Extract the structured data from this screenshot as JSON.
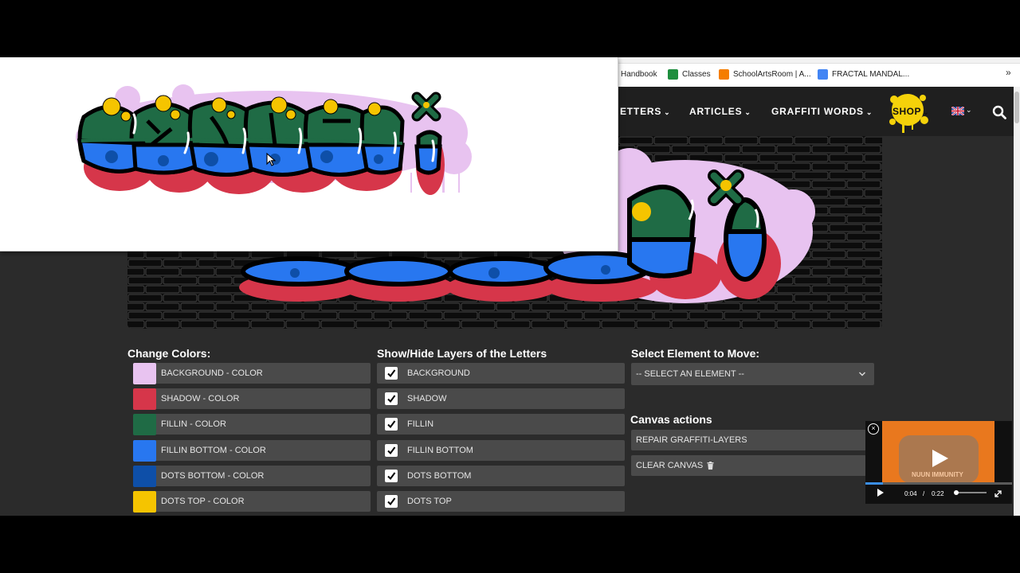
{
  "bookmarks": [
    {
      "label": "Handbook",
      "icon": "none"
    },
    {
      "label": "Classes",
      "icon": "classroom-icon",
      "color": "#1e8e3e"
    },
    {
      "label": "SchoolArtsRoom | A...",
      "icon": "blogger-icon",
      "color": "#f57d00"
    },
    {
      "label": "FRACTAL MANDAL...",
      "icon": "docs-icon",
      "color": "#4285f4"
    }
  ],
  "bookmarks_more": "»",
  "nav": {
    "items": [
      {
        "label": "ETTERS"
      },
      {
        "label": "ARTICLES"
      },
      {
        "label": "GRAFFITI WORDS"
      }
    ],
    "shop": "SHOP",
    "chevron": "⌄",
    "shop_color": "#f5d20a"
  },
  "graffiti": {
    "word": "SaGVZZi",
    "colors": {
      "background": "#e8c3f0",
      "shadow": "#d6364a",
      "fillin": "#1f6b45",
      "fillin_bottom": "#2877f0",
      "dots_bottom": "#0e4fa8",
      "dots_top": "#f5c400"
    }
  },
  "change_colors": {
    "title": "Change Colors:",
    "items": [
      {
        "label": "BACKGROUND - COLOR",
        "color": "#e8c3f0"
      },
      {
        "label": "SHADOW - COLOR",
        "color": "#d6364a"
      },
      {
        "label": "FILLIN - COLOR",
        "color": "#1f6b45"
      },
      {
        "label": "FILLIN BOTTOM - COLOR",
        "color": "#2877f0"
      },
      {
        "label": "DOTS BOTTOM - COLOR",
        "color": "#0e4fa8"
      },
      {
        "label": "DOTS TOP - COLOR",
        "color": "#f5c400"
      }
    ]
  },
  "layers": {
    "title": "Show/Hide Layers of the Letters",
    "items": [
      {
        "label": "BACKGROUND",
        "checked": true
      },
      {
        "label": "SHADOW",
        "checked": true
      },
      {
        "label": "FILLIN",
        "checked": true
      },
      {
        "label": "FILLIN BOTTOM",
        "checked": true
      },
      {
        "label": "DOTS BOTTOM",
        "checked": true
      },
      {
        "label": "DOTS TOP",
        "checked": true
      }
    ]
  },
  "move": {
    "title": "Select Element to Move:",
    "selected": "-- SELECT AN ELEMENT --"
  },
  "canvas_actions": {
    "title": "Canvas actions",
    "repair": "REPAIR GRAFFITI-LAYERS",
    "clear": "CLEAR CANVAS",
    "clear_icon": "trash-icon"
  },
  "video": {
    "caption": "NUUN IMMUNITY",
    "current": "0:04",
    "separator": "/",
    "duration": "0:22",
    "progress": 0.18,
    "close": "×"
  }
}
